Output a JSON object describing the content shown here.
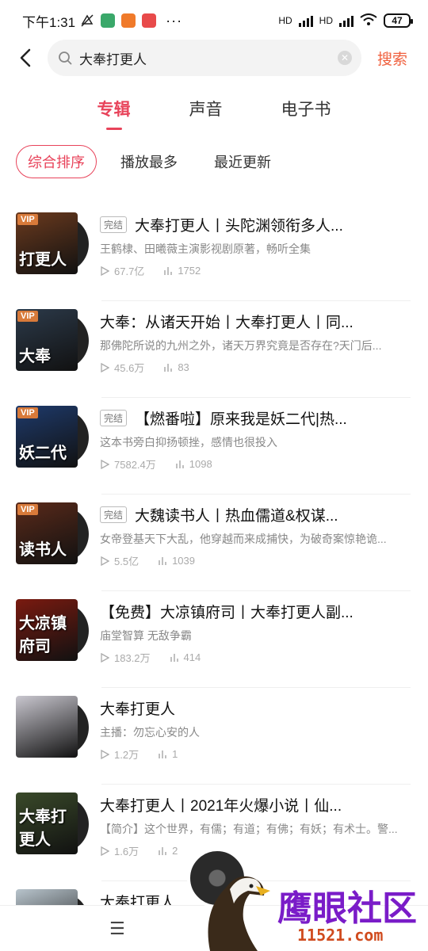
{
  "status_bar": {
    "time": "下午1:31",
    "dots": "···",
    "battery": "47",
    "net1": "HD",
    "net2": "HD"
  },
  "search": {
    "value": "大奉打更人",
    "button_label": "搜索"
  },
  "tabs": [
    {
      "label": "专辑"
    },
    {
      "label": "声音"
    },
    {
      "label": "电子书"
    }
  ],
  "sort": [
    {
      "label": "综合排序"
    },
    {
      "label": "播放最多"
    },
    {
      "label": "最近更新"
    }
  ],
  "items": [
    {
      "tag": "完结",
      "title": "大奉打更人丨头陀渊领衔多人...",
      "desc": "王鹤棣、田曦薇主演影视剧原著，畅听全集",
      "plays": "67.7亿",
      "tracks": "1752",
      "vip": "VIP",
      "cover_text": "打更人",
      "cover_color": "#6b3a1e"
    },
    {
      "tag": "",
      "title": "大奉：从诸天开始丨大奉打更人丨同...",
      "desc": "那佛陀所说的九州之外，诸天万界究竟是否存在?天门后...",
      "plays": "45.6万",
      "tracks": "83",
      "vip": "VIP",
      "cover_text": "大奉",
      "cover_color": "#2c3a4a"
    },
    {
      "tag": "完结",
      "title": "【燃番啦】原来我是妖二代|热...",
      "desc": "这本书旁白抑扬顿挫，感情也很投入",
      "plays": "7582.4万",
      "tracks": "1098",
      "vip": "VIP",
      "cover_text": "妖二代",
      "cover_color": "#1e3a6b"
    },
    {
      "tag": "完结",
      "title": "大魏读书人丨热血儒道&权谋...",
      "desc": "女帝登基天下大乱，他穿越而来成捕快，为破奇案惊艳诡...",
      "plays": "5.5亿",
      "tracks": "1039",
      "vip": "VIP",
      "cover_text": "读书人",
      "cover_color": "#5a2a1a"
    },
    {
      "tag": "",
      "title": "【免费】大凉镇府司丨大奉打更人副...",
      "desc": "庙堂智算 无敌争霸",
      "plays": "183.2万",
      "tracks": "414",
      "vip": "",
      "cover_text": "大凉镇府司",
      "cover_color": "#7a1a10"
    },
    {
      "tag": "",
      "title": "大奉打更人",
      "desc": "主播：勿忘心安的人",
      "plays": "1.2万",
      "tracks": "1",
      "vip": "",
      "cover_text": "",
      "cover_color": "#c9c7cf"
    },
    {
      "tag": "",
      "title": "大奉打更人丨2021年火爆小说丨仙...",
      "desc": "【简介】这个世界，有儒；有道；有佛；有妖；有术士。警...",
      "plays": "1.6万",
      "tracks": "2",
      "vip": "",
      "cover_text": "大奉打更人",
      "cover_color": "#3a4a2a"
    },
    {
      "tag": "",
      "title": "大奉打更人",
      "desc": "",
      "plays": "",
      "tracks": "",
      "vip": "",
      "cover_text": "",
      "cover_color": "#b8c4cc"
    }
  ],
  "watermark": {
    "text": "鹰眼社区",
    "url": "11521.com"
  },
  "colors": {
    "accent": "#e8435a",
    "search_button": "#f0603e"
  }
}
